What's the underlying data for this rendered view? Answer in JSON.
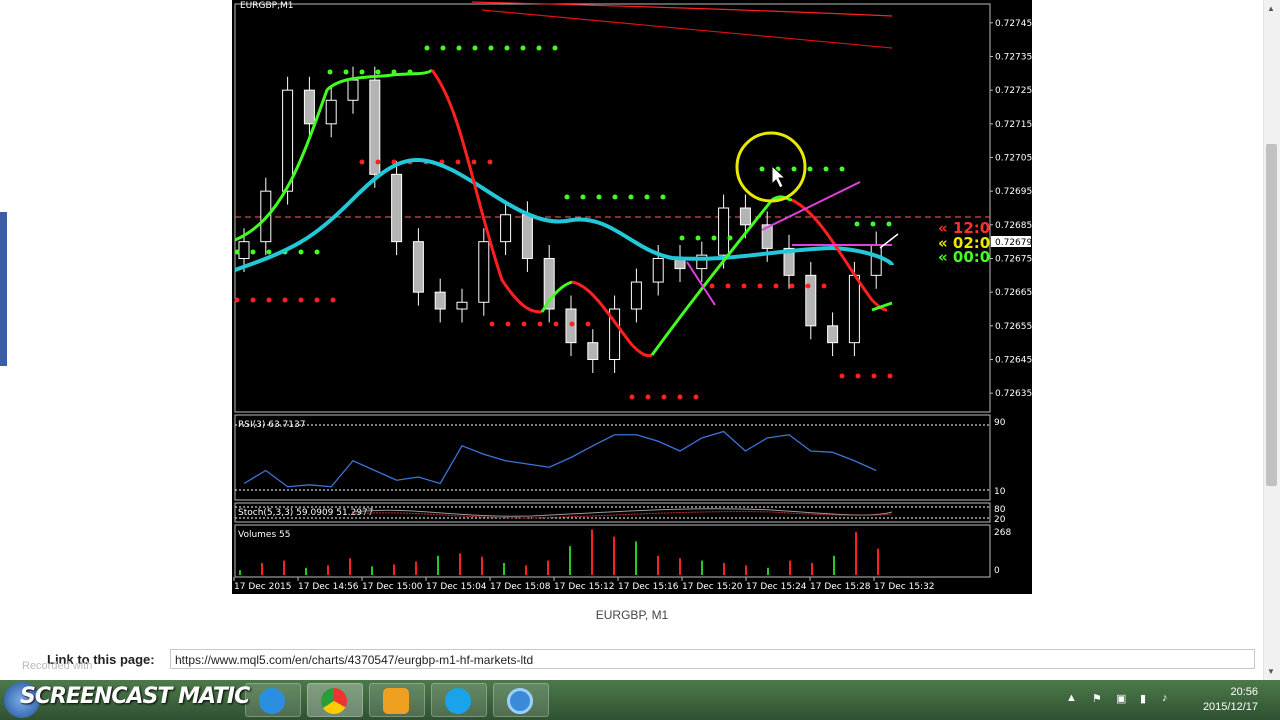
{
  "chart": {
    "symbol_label": "EURGBP,M1",
    "price_ticks": [
      "0.72745",
      "0.72735",
      "0.72725",
      "0.72715",
      "0.72705",
      "0.72695",
      "0.72685",
      "0.72675",
      "0.72665",
      "0.72655",
      "0.72645",
      "0.72635"
    ],
    "current_price": "0.72679",
    "time_ticks": [
      "17 Dec 2015",
      "17 Dec 14:56",
      "17 Dec 15:00",
      "17 Dec 15:04",
      "17 Dec 15:08",
      "17 Dec 15:12",
      "17 Dec 15:16",
      "17 Dec 15:20",
      "17 Dec 15:24",
      "17 Dec 15:28",
      "17 Dec 15:32"
    ],
    "rsi_label": "RSI(3) 63.7137",
    "rsi_levels": [
      "90",
      "10"
    ],
    "stoch_label": "Stoch(5,3,3) 59.0909 51.2977",
    "stoch_levels": [
      "80",
      "20"
    ],
    "volumes_label": "Volumes 55",
    "volume_levels": [
      "268",
      "0"
    ],
    "timer_labels": [
      "« 12:0",
      "« 02:0",
      "« 00:0"
    ],
    "colors": {
      "bg": "#000000",
      "bull_green": "#44ff22",
      "bear_red": "#ff2020",
      "ma_cyan": "#22c8d8",
      "rsi_blue": "#3d74d8",
      "annotation_yellow": "#e8e800",
      "magenta": "#e040e0"
    }
  },
  "caption": "EURGBP, M1",
  "link": {
    "label": "Link to this page:",
    "url": "https://www.mql5.com/en/charts/4370547/eurgbp-m1-hf-markets-ltd"
  },
  "overlay": {
    "recorded": "Recorded with",
    "brand": "SCREENCAST   MATIC"
  },
  "taskbar": {
    "time": "20:56",
    "date": "2015/12/17"
  },
  "chart_data": {
    "type": "line",
    "title": "EURGBP,M1",
    "xlabel": "",
    "ylabel": "",
    "ylim": [
      0.7263,
      0.7275
    ],
    "series": [
      {
        "name": "",
        "values": [
          0.7268,
          0.72695,
          0.72725,
          0.72715,
          0.72722,
          0.72728,
          0.727,
          0.7268,
          0.72665,
          0.7266,
          0.72662,
          0.7268,
          0.72688,
          0.72675,
          0.7266,
          0.7265,
          0.72645,
          0.7266,
          0.72668,
          0.72675,
          0.72672,
          0.72676,
          0.7269,
          0.72685,
          0.72678,
          0.7267,
          0.72655,
          0.7265,
          0.7267,
          0.72679
        ]
      }
    ]
  }
}
